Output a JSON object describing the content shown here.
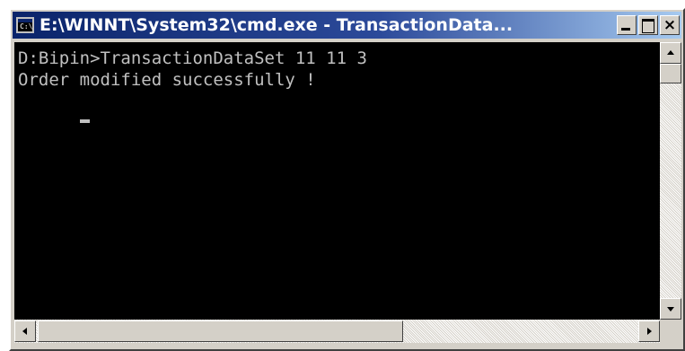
{
  "window": {
    "title": "E:\\WINNT\\System32\\cmd.exe - TransactionData...",
    "icon": "command-prompt-icon",
    "icon_glyph": "C:\\",
    "buttons": {
      "minimize_icon": "minimize-icon",
      "maximize_icon": "maximize-icon",
      "close_icon": "close-icon",
      "close_glyph": "×"
    }
  },
  "console": {
    "lines": [
      "D:Bipin>TransactionDataSet 11 11 3",
      "Order modified successfully !"
    ],
    "cursor": "blinking-underscore-cursor",
    "colors": {
      "background": "#000000",
      "foreground": "#c0c0c0"
    }
  },
  "scrollbars": {
    "vertical": {
      "up_icon": "scroll-up-arrow-icon",
      "down_icon": "scroll-down-arrow-icon"
    },
    "horizontal": {
      "left_icon": "scroll-left-arrow-icon",
      "right_icon": "scroll-right-arrow-icon"
    }
  },
  "theme": {
    "titlebar_start": "#0a246a",
    "titlebar_end": "#a6caf0",
    "chrome": "#d4d0c8"
  }
}
